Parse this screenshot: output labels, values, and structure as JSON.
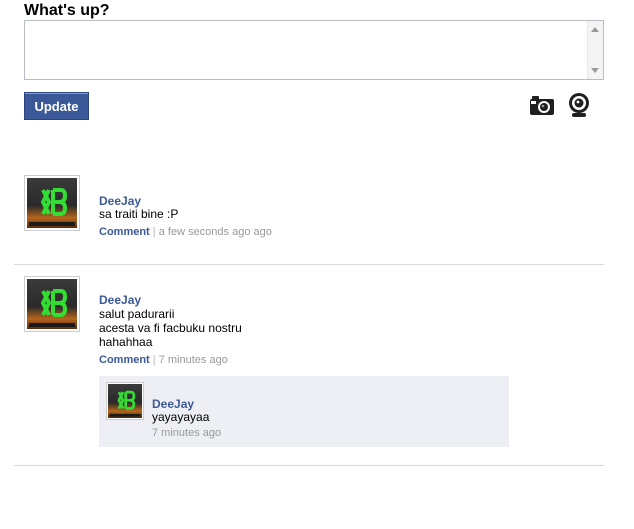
{
  "composer": {
    "title": "What's up?",
    "value": "",
    "update_label": "Update"
  },
  "icons": {
    "camera": "camera-icon",
    "webcam": "webcam-icon"
  },
  "colors": {
    "accent": "#3b5998",
    "meta_text": "#999999",
    "reply_bg": "#edeff4"
  },
  "posts": [
    {
      "author": "DeeJay",
      "message": "sa traiti bine :P",
      "comment_label": "Comment",
      "separator": "|",
      "time": "a few seconds ago ago"
    },
    {
      "author": "DeeJay",
      "message": "salut padurarii\nacesta va fi facbuku nostru\nhahahhaa",
      "comment_label": "Comment",
      "separator": "|",
      "time": "7 minutes ago",
      "replies": [
        {
          "author": "DeeJay",
          "message": "yayayayaa",
          "time": "7 minutes ago"
        }
      ]
    }
  ]
}
